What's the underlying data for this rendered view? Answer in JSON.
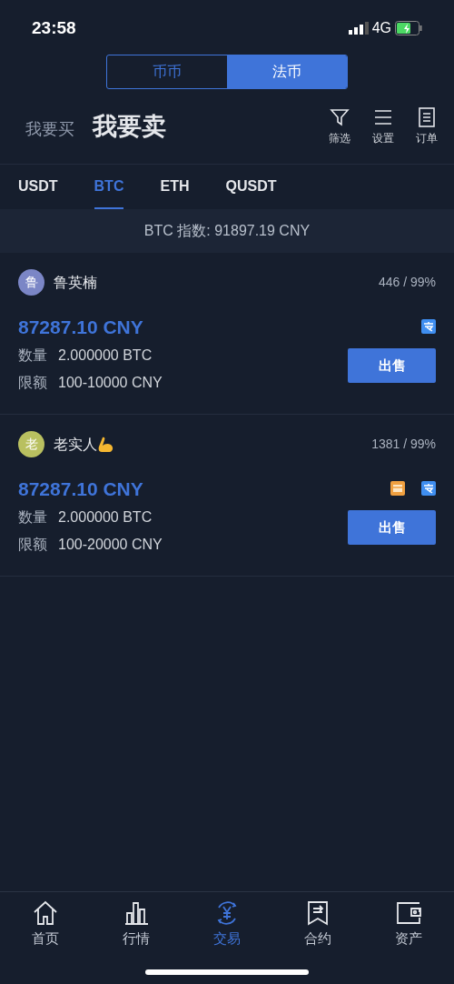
{
  "status_bar": {
    "time": "23:58",
    "network": "4G"
  },
  "mode_switch": [
    {
      "label": "币币",
      "selected": false
    },
    {
      "label": "法币",
      "selected": true
    }
  ],
  "sides": [
    {
      "label": "我要买",
      "selected": false
    },
    {
      "label": "我要卖",
      "selected": true
    }
  ],
  "header_actions": [
    {
      "kind": "filter",
      "label": "筛选"
    },
    {
      "kind": "settings",
      "label": "设置"
    },
    {
      "kind": "orders",
      "label": "订单"
    }
  ],
  "coin_tabs": [
    {
      "label": "USDT",
      "selected": false
    },
    {
      "label": "BTC",
      "selected": true
    },
    {
      "label": "ETH",
      "selected": false
    },
    {
      "label": "QUSDT",
      "selected": false
    }
  ],
  "index_bar": "BTC 指数: 91897.19 CNY",
  "listings": [
    {
      "avatar": "鲁",
      "color": "#7b86c6",
      "name": "鲁英楠",
      "stats": "446 / 99%",
      "price": "87287.10 CNY",
      "quantity_label": "数量",
      "quantity": "2.000000 BTC",
      "limit_label": "限额",
      "limit": "100-10000 CNY",
      "payments": [
        {
          "kind": "alipay"
        }
      ],
      "action": "出售"
    },
    {
      "avatar": "老",
      "color": "#b9c060",
      "name": "老实人",
      "name_badge": {
        "kind": "flexed-arm"
      },
      "stats": "1381 / 99%",
      "price": "87287.10 CNY",
      "quantity_label": "数量",
      "quantity": "2.000000 BTC",
      "limit_label": "限额",
      "limit": "100-20000 CNY",
      "payments": [
        {
          "kind": "bank"
        },
        {
          "kind": "alipay"
        }
      ],
      "action": "出售"
    }
  ],
  "bottom_nav": [
    {
      "kind": "home",
      "label": "首页",
      "selected": false
    },
    {
      "kind": "market",
      "label": "行情",
      "selected": false
    },
    {
      "kind": "trade",
      "label": "交易",
      "selected": true
    },
    {
      "kind": "contract",
      "label": "合约",
      "selected": false
    },
    {
      "kind": "assets",
      "label": "资产",
      "selected": false
    }
  ]
}
